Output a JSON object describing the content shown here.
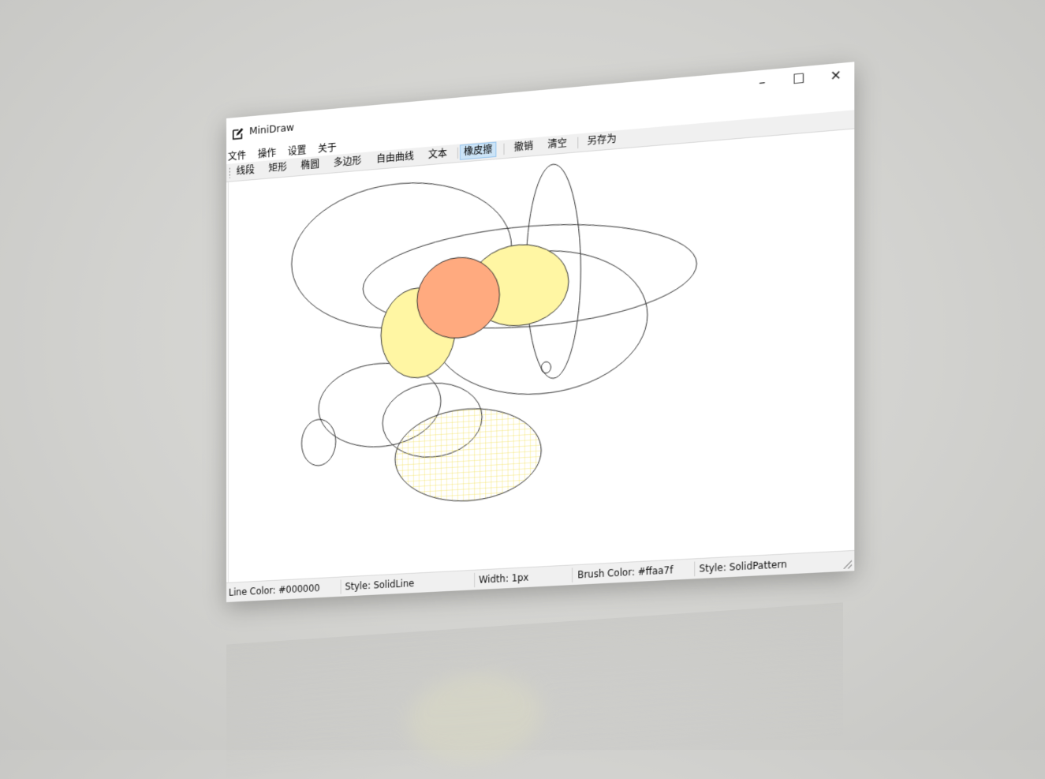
{
  "window": {
    "title": "MiniDraw",
    "minimize_glyph": "–",
    "maximize_glyph": "☐",
    "close_glyph": "✕"
  },
  "menu": [
    "文件",
    "操作",
    "设置",
    "关于"
  ],
  "toolbar": {
    "items": [
      "线段",
      "矩形",
      "椭圆",
      "多边形",
      "自由曲线",
      "文本",
      "橡皮擦",
      "撤销",
      "清空",
      "另存为"
    ],
    "active_item": "橡皮擦"
  },
  "status": {
    "line_color": "Line Color: #000000",
    "line_style": "Style: SolidLine",
    "width": "Width: 1px",
    "brush_color": "Brush Color: #ffaa7f",
    "brush_style": "Style: SolidPattern"
  },
  "colors": {
    "stroke": "#000000",
    "yellow_fill": "#fff6a3",
    "orange_fill": "#ffaa7f",
    "hatch": "#f2e25a"
  },
  "icons": {
    "app": "edit-square-icon"
  }
}
